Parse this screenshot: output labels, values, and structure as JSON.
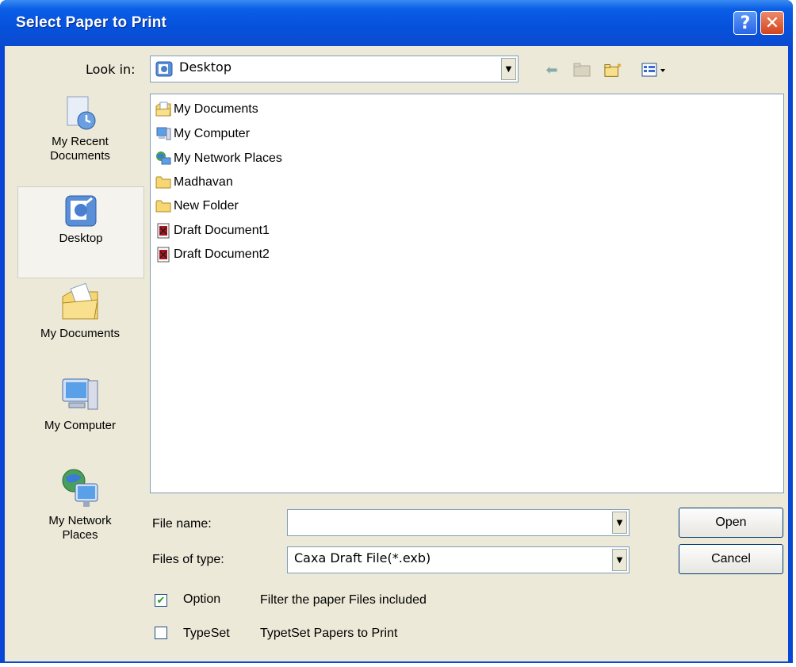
{
  "window": {
    "title": "Select Paper to Print"
  },
  "look_in": {
    "label": "Look in:",
    "value": "Desktop"
  },
  "places": [
    {
      "label_line1": "My Recent",
      "label_line2": "Documents"
    },
    {
      "label_line1": "Desktop",
      "label_line2": ""
    },
    {
      "label_line1": "My Documents",
      "label_line2": ""
    },
    {
      "label_line1": "My Computer",
      "label_line2": ""
    },
    {
      "label_line1": "My Network",
      "label_line2": "Places"
    }
  ],
  "files": [
    {
      "name": "My Documents",
      "icon": "my-documents-icon"
    },
    {
      "name": "My Computer",
      "icon": "my-computer-icon"
    },
    {
      "name": "My Network Places",
      "icon": "network-places-icon"
    },
    {
      "name": "Madhavan",
      "icon": "folder-icon"
    },
    {
      "name": "New Folder",
      "icon": "folder-icon"
    },
    {
      "name": "Draft Document1",
      "icon": "draft-file-icon"
    },
    {
      "name": "Draft Document2",
      "icon": "draft-file-icon"
    }
  ],
  "file_name": {
    "label": "File name:",
    "value": ""
  },
  "file_type": {
    "label": "Files of type:",
    "value": "Caxa Draft File(*.exb)"
  },
  "buttons": {
    "open": "Open",
    "cancel": "Cancel"
  },
  "options": [
    {
      "label": "Option",
      "description": "Filter the paper Files included",
      "checked": true
    },
    {
      "label": "TypeSet",
      "description": "TypetSet Papers to Print",
      "checked": false
    }
  ],
  "colors": {
    "titlebar": "#0651db",
    "dialog_bg": "#ece9d8",
    "check": "#21a121"
  }
}
